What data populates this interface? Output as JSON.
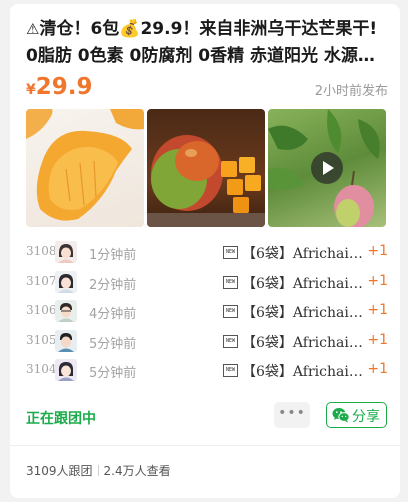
{
  "post": {
    "title_prefix": "⚠",
    "title": "清仓！6包💰29.9！来自非洲乌干达芒果干!0脂肪 0色素 0防腐剂 0香精 赤道阳光 水源充足 多汁饱满",
    "price_symbol": "¥",
    "price": "29.9",
    "posted": "2小时前发布",
    "images": [
      {
        "icon": "dried-mango-photo"
      },
      {
        "icon": "fresh-mango-photo"
      },
      {
        "icon": "mango-tree-video",
        "is_video": true
      }
    ]
  },
  "records": [
    {
      "no": "3108",
      "time": "1分钟前",
      "item": "【6袋】Africhain…",
      "qty": "+1",
      "avatar": "avatar-girl"
    },
    {
      "no": "3107",
      "time": "2分钟前",
      "item": "【6袋】Africhain…",
      "qty": "+1",
      "avatar": "avatar-girl"
    },
    {
      "no": "3106",
      "time": "4分钟前",
      "item": "【6袋】Africhain…",
      "qty": "+1",
      "avatar": "avatar-boy"
    },
    {
      "no": "3105",
      "time": "5分钟前",
      "item": "【6袋】Africhain…",
      "qty": "+1",
      "avatar": "avatar-boy"
    },
    {
      "no": "3104",
      "time": "5分钟前",
      "item": "【6袋】Africhain…",
      "qty": "+1",
      "avatar": "avatar-girl"
    }
  ],
  "actions": {
    "status": "正在跟团中",
    "more": "•••",
    "share": "分享"
  },
  "footer": {
    "joined": "3109人跟团",
    "views": "2.4万人查看"
  },
  "colors": {
    "accent": "#f0762e",
    "green": "#1aac4a"
  }
}
